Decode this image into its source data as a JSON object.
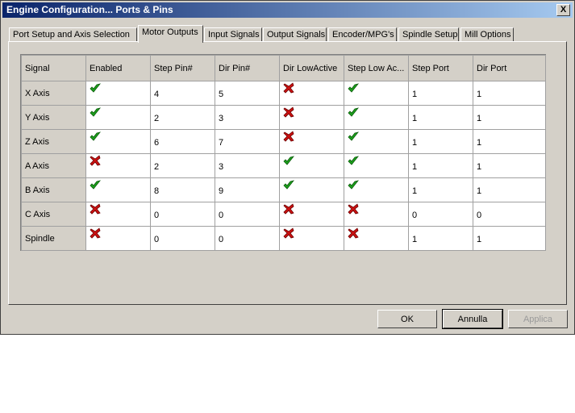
{
  "window": {
    "title": "Engine Configuration... Ports & Pins",
    "close_glyph": "X"
  },
  "tabs": [
    {
      "label": "Port Setup and Axis Selection"
    },
    {
      "label": "Motor Outputs"
    },
    {
      "label": "Input Signals"
    },
    {
      "label": "Output Signals"
    },
    {
      "label": "Encoder/MPG's"
    },
    {
      "label": "Spindle Setup"
    },
    {
      "label": "Mill Options"
    }
  ],
  "active_tab": "Motor Outputs",
  "table": {
    "headers": [
      "Signal",
      "Enabled",
      "Step Pin#",
      "Dir Pin#",
      "Dir LowActive",
      "Step Low Ac...",
      "Step Port",
      "Dir Port"
    ],
    "rows": [
      {
        "signal": "X Axis",
        "enabled": "check-icon",
        "step_pin": "4",
        "dir_pin": "5",
        "dir_low_active": "cross-icon",
        "step_low_active": "check-icon",
        "step_port": "1",
        "dir_port": "1"
      },
      {
        "signal": "Y Axis",
        "enabled": "check-icon",
        "step_pin": "2",
        "dir_pin": "3",
        "dir_low_active": "cross-icon",
        "step_low_active": "check-icon",
        "step_port": "1",
        "dir_port": "1"
      },
      {
        "signal": "Z Axis",
        "enabled": "check-icon",
        "step_pin": "6",
        "dir_pin": "7",
        "dir_low_active": "cross-icon",
        "step_low_active": "check-icon",
        "step_port": "1",
        "dir_port": "1"
      },
      {
        "signal": "A Axis",
        "enabled": "cross-icon",
        "step_pin": "2",
        "dir_pin": "3",
        "dir_low_active": "check-icon",
        "step_low_active": "check-icon",
        "step_port": "1",
        "dir_port": "1"
      },
      {
        "signal": "B Axis",
        "enabled": "check-icon",
        "step_pin": "8",
        "dir_pin": "9",
        "dir_low_active": "check-icon",
        "step_low_active": "check-icon",
        "step_port": "1",
        "dir_port": "1"
      },
      {
        "signal": "C Axis",
        "enabled": "cross-icon",
        "step_pin": "0",
        "dir_pin": "0",
        "dir_low_active": "cross-icon",
        "step_low_active": "cross-icon",
        "step_port": "0",
        "dir_port": "0"
      },
      {
        "signal": "Spindle",
        "enabled": "cross-icon",
        "step_pin": "0",
        "dir_pin": "0",
        "dir_low_active": "cross-icon",
        "step_low_active": "cross-icon",
        "step_port": "1",
        "dir_port": "1"
      }
    ]
  },
  "buttons": {
    "ok": "OK",
    "cancel": "Annulla",
    "apply": "Applica"
  },
  "colors": {
    "check": "#1ca01c",
    "cross": "#cc1111",
    "titlebar_start": "#0a246a",
    "titlebar_end": "#a6caf0"
  }
}
